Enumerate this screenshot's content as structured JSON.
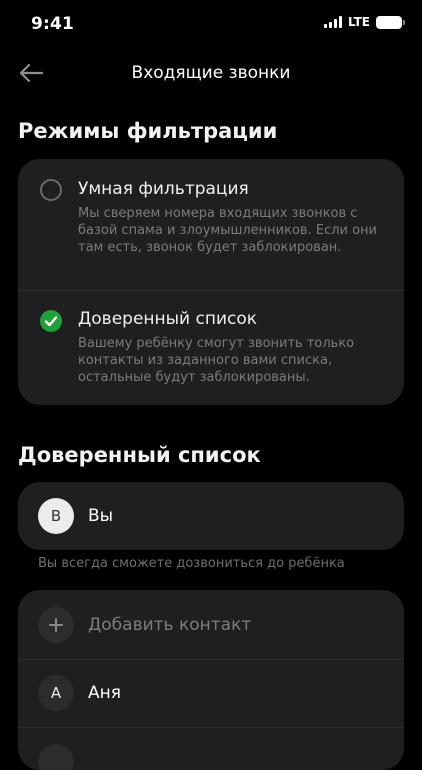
{
  "status_bar": {
    "time": "9:41",
    "network": "LTE"
  },
  "header": {
    "title": "Входящие звонки"
  },
  "filter_section": {
    "title": "Режимы фильтрации",
    "options": [
      {
        "title": "Умная фильтрация",
        "description": "Мы сверяем номера входящих звонков с базой спама и злоумышленников. Если они там есть, звонок будет заблокирован.",
        "selected": false
      },
      {
        "title": "Доверенный список",
        "description": "Вашему ребёнку смогут звонить только контакты из заданного вами списка, остальные будут заблокированы.",
        "selected": true
      }
    ]
  },
  "trusted_section": {
    "title": "Доверенный список",
    "self": {
      "initial": "В",
      "name": "Вы"
    },
    "hint": "Вы всегда сможете дозвониться до ребёнка",
    "add_label": "Добавить контакт",
    "contacts": [
      {
        "initial": "А",
        "name": "Аня"
      }
    ]
  },
  "colors": {
    "accent": "#21a038",
    "card": "#1f1f21"
  }
}
